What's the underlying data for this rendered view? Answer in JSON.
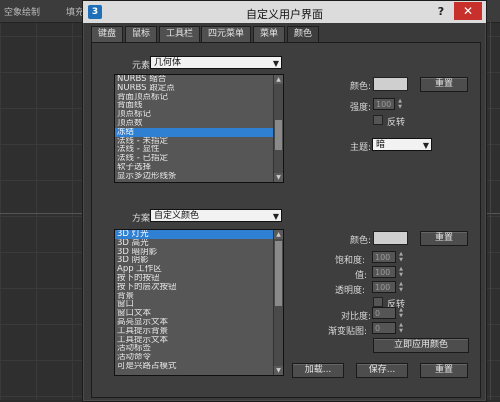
{
  "background": {
    "tab1": "空象绘制",
    "tab2": "填充"
  },
  "dialog": {
    "title": "自定义用户界面",
    "help": "?",
    "close": "✕",
    "icon_letter": "3",
    "tabs": [
      "键盘",
      "鼠标",
      "工具栏",
      "四元菜单",
      "菜单",
      "颜色"
    ],
    "active_tab": 5
  },
  "elements": {
    "label": "元素:",
    "value": "几何体",
    "items": [
      "NURBS 缩合",
      "NURBS 跟定点",
      "背面顶点标记",
      "背面线",
      "顶点标记",
      "顶点数",
      "冻结",
      "法线 - 未指定",
      "法线 - 显性",
      "法线 - 已指定",
      "软子选择",
      "显示多边形线条"
    ],
    "selected": 6
  },
  "right_top": {
    "color_label": "颜色:",
    "reset_label": "重置",
    "intensity_label": "强度:",
    "intensity_value": "100",
    "invert_label": "反转",
    "theme_label": "主题:",
    "theme_value": "暗"
  },
  "scheme": {
    "label": "方案:",
    "value": "自定义颜色",
    "items": [
      "3D 灯光",
      "3D 高光",
      "3D 暗阴影",
      "3D 阴影",
      "App 工作区",
      "按下的按钮",
      "按下的层次按钮",
      "背景",
      "窗口",
      "窗口文本",
      "高亮显示文本",
      "工具提示背景",
      "工具提示文本",
      "活动标签",
      "活动命令",
      "可是兴路占模式"
    ],
    "selected": 0
  },
  "right_bottom": {
    "color_label": "颜色:",
    "reset_label": "重置",
    "saturation_label": "饱和度:",
    "saturation_value": "100",
    "value_label": "值:",
    "value_value": "100",
    "transparency_label": "透明度:",
    "transparency_value": "100",
    "invert_label": "反转",
    "contrast_label": "对比度:",
    "contrast_value": "0",
    "gradient_label": "渐变贴图:",
    "gradient_value": "0",
    "apply_label": "立即应用颜色"
  },
  "footer": {
    "load_label": "加载...",
    "save_label": "保存...",
    "reset_label": "重置"
  }
}
